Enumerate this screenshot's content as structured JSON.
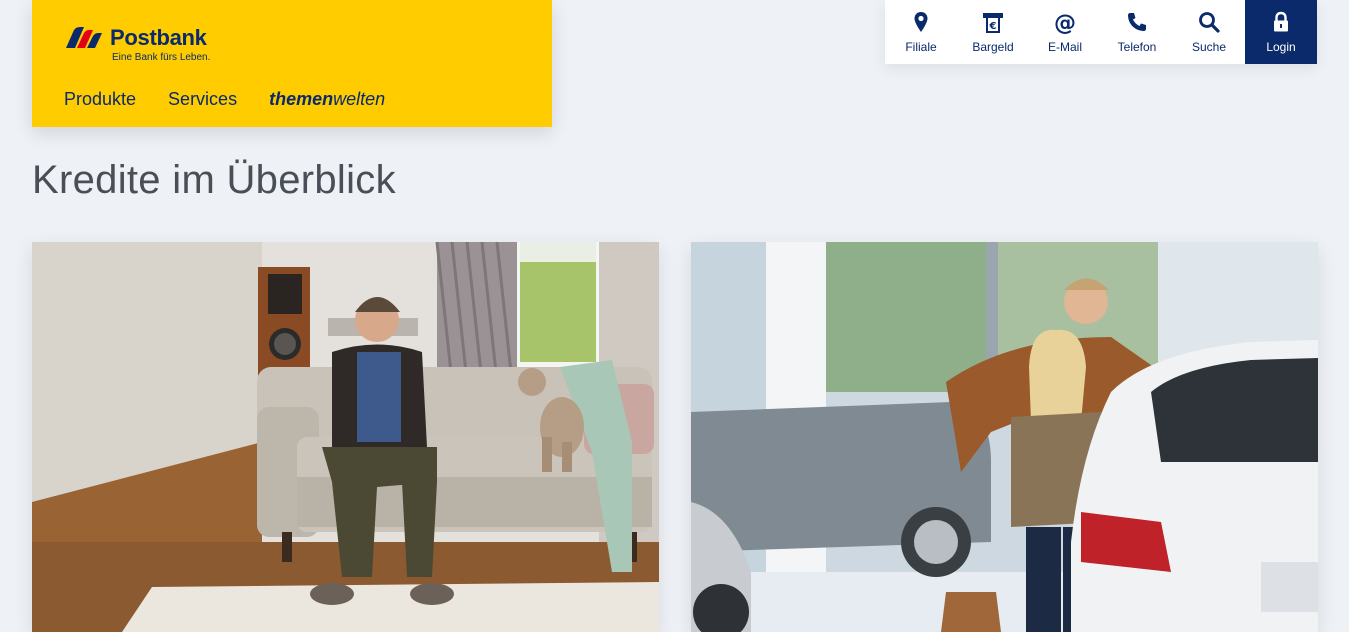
{
  "brand": {
    "name": "Postbank",
    "slogan": "Eine Bank fürs Leben."
  },
  "nav": {
    "items": [
      {
        "label": "Produkte"
      },
      {
        "label": "Services"
      },
      {
        "label_bold": "themen",
        "label_rest": "welten"
      }
    ]
  },
  "quick_links": [
    {
      "label": "Filiale",
      "icon": "location-pin-icon"
    },
    {
      "label": "Bargeld",
      "icon": "atm-euro-icon"
    },
    {
      "label": "E-Mail",
      "icon": "at-sign-icon"
    },
    {
      "label": "Telefon",
      "icon": "phone-icon"
    },
    {
      "label": "Suche",
      "icon": "search-icon"
    },
    {
      "label": "Login",
      "icon": "lock-icon"
    }
  ],
  "page": {
    "title": "Kredite im Überblick"
  },
  "colors": {
    "brand_yellow": "#ffcc00",
    "brand_blue": "#0a2a6b",
    "background": "#eef1f6"
  }
}
